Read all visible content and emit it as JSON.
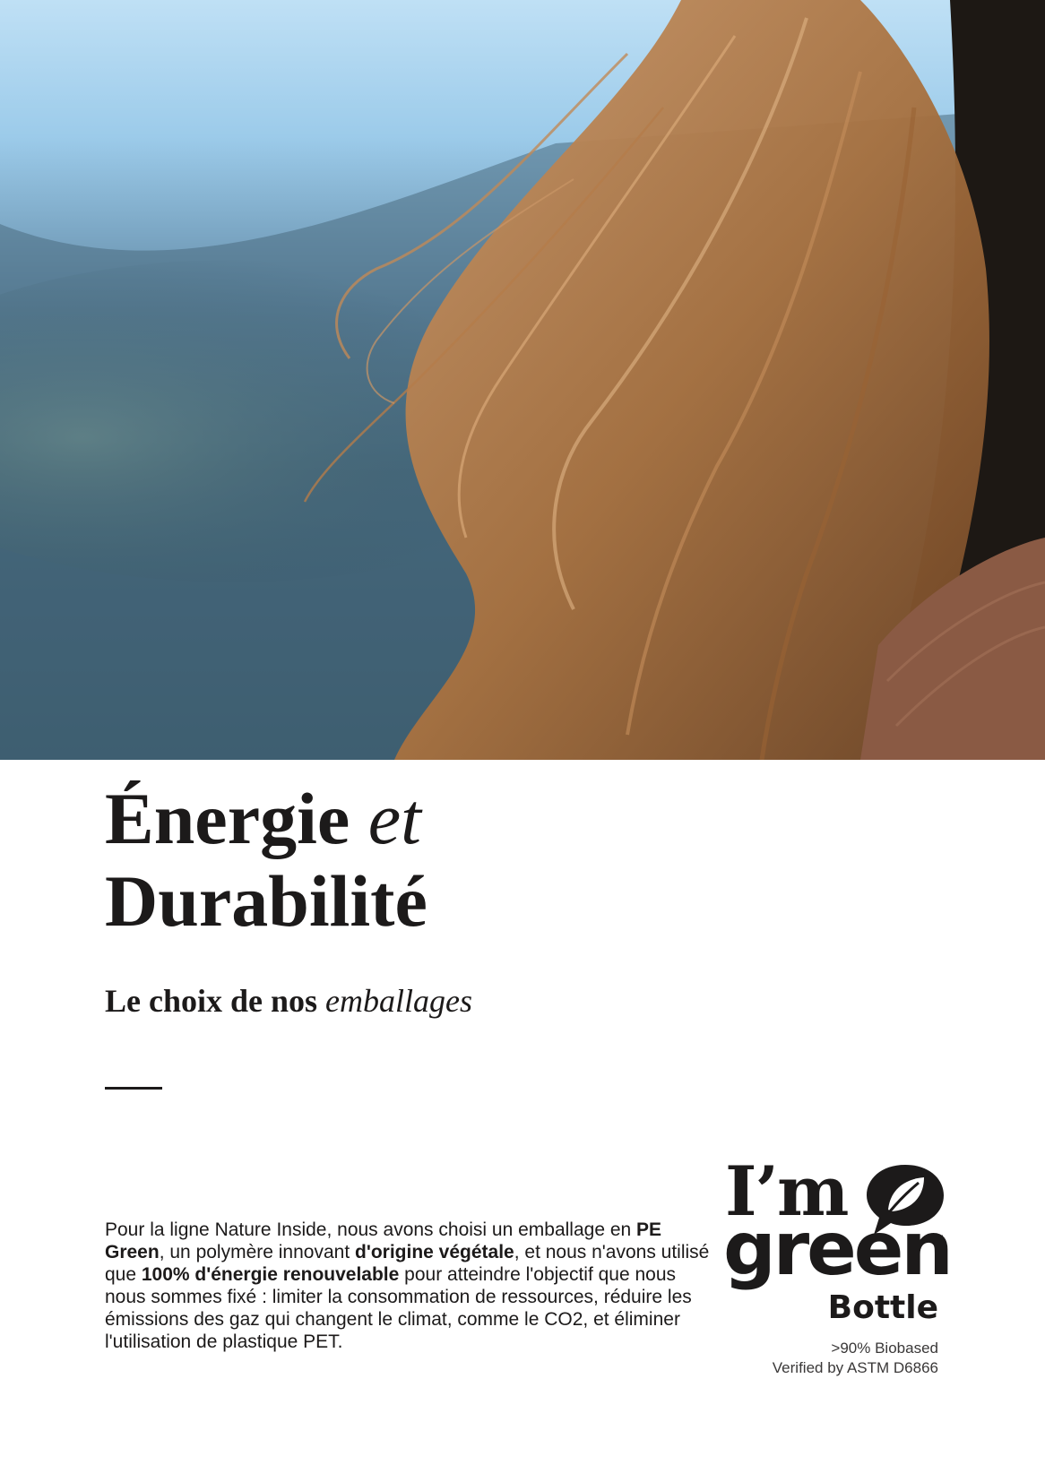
{
  "hero": {
    "alt": "photo-hair-in-wind"
  },
  "title": {
    "line1_word": "Énergie",
    "line1_italic": "et",
    "line2": "Durabilité"
  },
  "subtitle": {
    "text": "Le choix de nos",
    "italic": "emballages"
  },
  "body": {
    "p1": "Pour la ligne Nature Inside, nous avons choisi un emballage en ",
    "b1": "PE Green",
    "p2": ", un polymère innovant ",
    "b2": "d'origine végétale",
    "p3": ", et nous n'avons utilisé que ",
    "b3": "100% d'énergie renouvelable",
    "p4": " pour atteindre l'objectif que nous nous sommes fixé : limiter la consommation de ressources, réduire les émissions des gaz qui changent le climat, comme le CO2, et éliminer l'utilisation de plastique PET."
  },
  "logo": {
    "im": "I’m",
    "green": "green",
    "tm": "™",
    "bottle": "Bottle",
    "line1": ">90% Biobased",
    "line2": "Verified by ASTM D6866",
    "icon": "leaf-speech-bubble-icon"
  },
  "colors": {
    "text": "#1c1a1a",
    "hair": "#b07a4a",
    "sky": "#bfe0f5",
    "sweater": "#8a5a44"
  }
}
